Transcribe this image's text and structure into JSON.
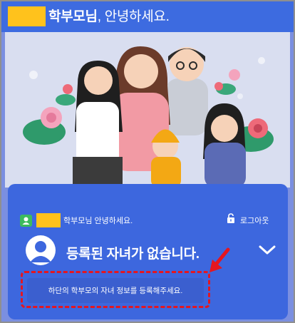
{
  "header": {
    "greeting_bold": "학부모님",
    "greeting_rest": ", 안녕하세요."
  },
  "user_row": {
    "text": "학부모님 안녕하세요.",
    "logout_label": "로그아웃"
  },
  "child_panel": {
    "status_text": "등록된 자녀가 없습니다.",
    "register_button_label": "하단의 학부모의 자녀 정보를 등록해주세요."
  },
  "colors": {
    "brand_blue": "#3d6be0",
    "redacted_name": "#ffc21c",
    "annotation_red": "#e5161f"
  },
  "icons": [
    "user-badge-icon",
    "lock-icon",
    "person-avatar-icon",
    "chevron-down-icon",
    "annotation-arrow-icon"
  ]
}
